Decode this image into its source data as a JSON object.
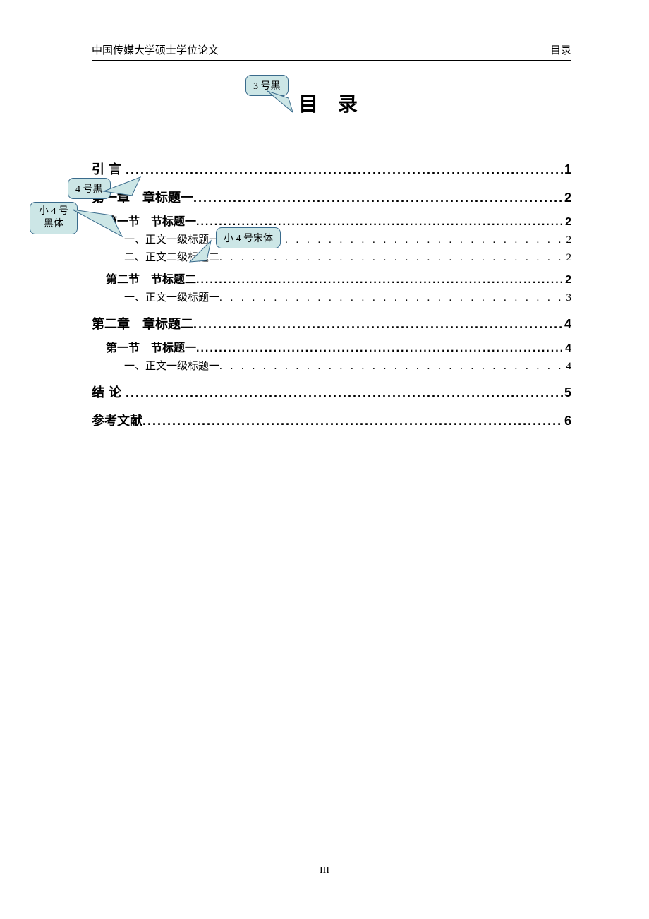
{
  "header": {
    "left": "中国传媒大学硕士学位论文",
    "right": "目录"
  },
  "title": "目 录",
  "callouts": {
    "c1": "3 号黑",
    "c2": "4 号黑",
    "c3": "小 4 号\n黑体",
    "c4": "小 4 号宋体"
  },
  "toc": [
    {
      "label": "引言",
      "page": "1",
      "cls": "lvl0"
    },
    {
      "label": "第一章　章标题一",
      "page": "2",
      "cls": "lvl1"
    },
    {
      "label": "第一节　节标题一",
      "page": "2",
      "cls": "lvl2"
    },
    {
      "label": "一、正文一级标题一",
      "page": "2",
      "cls": "lvl3"
    },
    {
      "label": "二、正文二级标题二",
      "page": "2",
      "cls": "lvl3"
    },
    {
      "label": "第二节　节标题二",
      "page": "2",
      "cls": "lvl2"
    },
    {
      "label": "一、正文一级标题一",
      "page": "3",
      "cls": "lvl3"
    },
    {
      "label": "第二章　章标题二",
      "page": "4",
      "cls": "lvl1"
    },
    {
      "label": "第一节　节标题一",
      "page": "4",
      "cls": "lvl2"
    },
    {
      "label": "一、正文一级标题一",
      "page": "4",
      "cls": "lvl3"
    },
    {
      "label": "结论",
      "page": "5",
      "cls": "lvl0"
    },
    {
      "label": "参考文献",
      "page": "6",
      "cls": "lvl0 nospace"
    }
  ],
  "footer_page": "III"
}
